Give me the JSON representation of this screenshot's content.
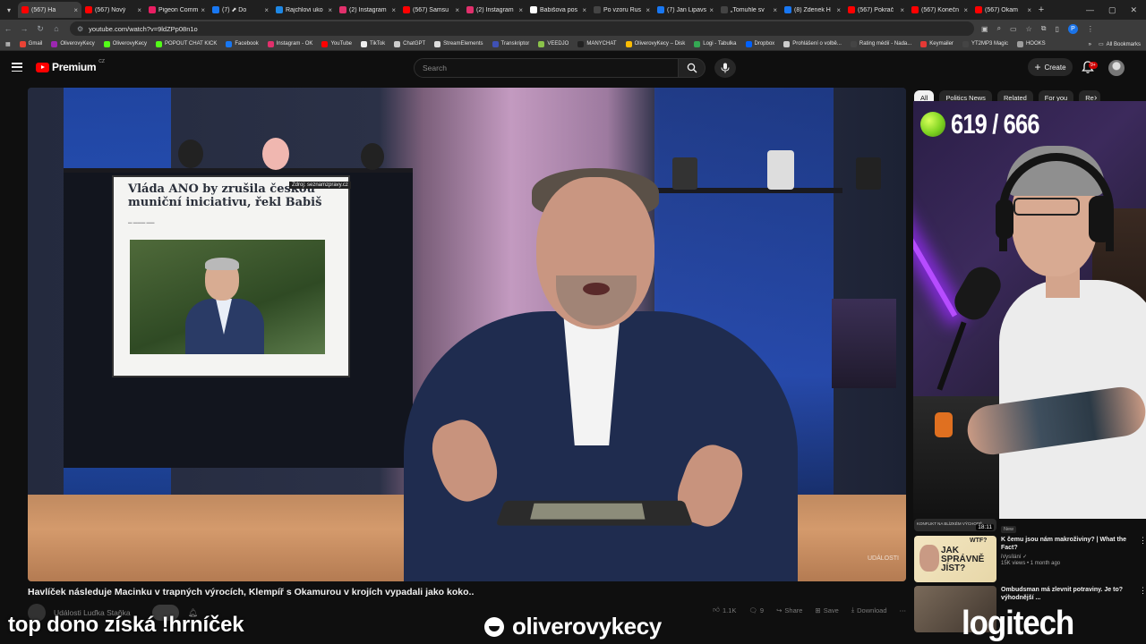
{
  "browser": {
    "tabs": [
      {
        "label": "(567) Ha",
        "color": "#ff0000",
        "active": true
      },
      {
        "label": "(567) Nový",
        "color": "#ff0000"
      },
      {
        "label": "Pigeon Comm",
        "color": "#e91e63"
      },
      {
        "label": "(7) ⬈ Do",
        "color": "#1877f2"
      },
      {
        "label": "Rajchlovi uko",
        "color": "#1e88e5"
      },
      {
        "label": "(2) Instagram",
        "color": "#e1306c"
      },
      {
        "label": "(567) Samsu",
        "color": "#ff0000"
      },
      {
        "label": "(2) Instagram",
        "color": "#e1306c"
      },
      {
        "label": "Babišova pos",
        "color": "#ffffff"
      },
      {
        "label": "Po vzoru Rus",
        "color": "#444444"
      },
      {
        "label": "(7) Jan Lipavs",
        "color": "#1877f2"
      },
      {
        "label": "„Tomuhle sv",
        "color": "#444444"
      },
      {
        "label": "(8) Zdenek H",
        "color": "#1877f2"
      },
      {
        "label": "(567) Pokrač",
        "color": "#ff0000"
      },
      {
        "label": "(567) Konečn",
        "color": "#ff0000"
      },
      {
        "label": "(567) Okam",
        "color": "#ff0000"
      }
    ],
    "url": "youtube.com/watch?v=9ldZPp08n1o",
    "profile_initial": "P",
    "bookmarks": [
      {
        "label": "Gmail",
        "color": "#ea4335"
      },
      {
        "label": "OliverovyKecy",
        "color": "#9c27b0"
      },
      {
        "label": "OliverovyKecy",
        "color": "#53fc18"
      },
      {
        "label": "POPOUT CHAT KICK",
        "color": "#53fc18"
      },
      {
        "label": "Facebook",
        "color": "#1877f2"
      },
      {
        "label": "Instagram - OK",
        "color": "#e1306c"
      },
      {
        "label": "YouTube",
        "color": "#ff0000"
      },
      {
        "label": "TikTok",
        "color": "#eeeeee"
      },
      {
        "label": "ChatGPT",
        "color": "#cccccc"
      },
      {
        "label": "StreamElements",
        "color": "#dddddd"
      },
      {
        "label": "Transkriptor",
        "color": "#3f51b5"
      },
      {
        "label": "VEEDJO",
        "color": "#8bc34a"
      },
      {
        "label": "MANYCHAT",
        "color": "#222222"
      },
      {
        "label": "OliverovyKecy – Disk",
        "color": "#fbbc04"
      },
      {
        "label": "Logi - Tabulka",
        "color": "#34a853"
      },
      {
        "label": "Dropbox",
        "color": "#0061fe"
      },
      {
        "label": "Prohlášení o volbě...",
        "color": "#cccccc"
      },
      {
        "label": "Rating médií - Nada...",
        "color": "#444444"
      },
      {
        "label": "Keymailer",
        "color": "#e53935"
      },
      {
        "label": "YT2MP3 Magic",
        "color": "#444444"
      },
      {
        "label": "HOOKS",
        "color": "#9e9e9e"
      }
    ],
    "all_bookmarks_label": "All Bookmarks"
  },
  "youtube": {
    "logo_text": "Premium",
    "country_code": "CZ",
    "search_placeholder": "Search",
    "create_label": "Create",
    "notification_badge": "9+",
    "video_title": "Havlíček následuje Macinku v trapných výrocích, Klempíř s Okamurou v krojích vypadali jako koko..",
    "channel_name": "Události Luďka Staňka",
    "actions": {
      "likes": "1.1K",
      "comments": "9",
      "share": "Share",
      "save": "Save",
      "download": "Download"
    },
    "chips": [
      {
        "label": "All",
        "active": true
      },
      {
        "label": "Politics News"
      },
      {
        "label": "Related"
      },
      {
        "label": "For you"
      },
      {
        "label": "Re"
      }
    ],
    "in_video": {
      "headline": "Vláda ANO by zrušila českou muniční iniciativu, řekl Babiš",
      "source": "Zdroj: seznamzpravy.cz",
      "watermark": "UDÁLOSTI"
    },
    "related": [
      {
        "title": "KONFLIKT NA BLÍZKÉM VÝCHODĚ",
        "duration": "18:11",
        "badge": "New"
      },
      {
        "title": "K čemu jsou nám makroživiny? | What the Fact?",
        "channel": "iVysílání",
        "views": "15K views • 1 month ago",
        "thumb_text": "JAK SPRÁVNĚ JÍST?",
        "thumb_tag": "WTF?"
      },
      {
        "title": "Ombudsman má zlevnit potraviny. Je to? výhodnější ...",
        "channel": "",
        "views": ""
      }
    ]
  },
  "overlays": {
    "counter": "619 / 666",
    "left_text": "top dono získá !hrníček",
    "handle": "oliverovykecy",
    "sponsor": "logitech"
  }
}
